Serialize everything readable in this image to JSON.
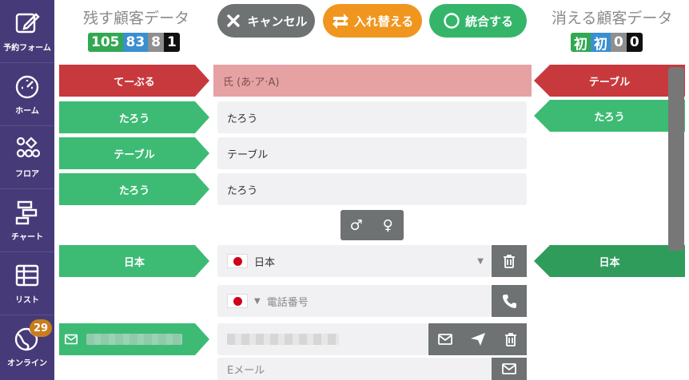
{
  "sidebar": {
    "items": [
      {
        "label": "予約フォーム",
        "icon": "edit-icon"
      },
      {
        "label": "ホーム",
        "icon": "gauge-icon"
      },
      {
        "label": "フロア",
        "icon": "shapes-icon"
      },
      {
        "label": "チャート",
        "icon": "chart-blocks-icon"
      },
      {
        "label": "リスト",
        "icon": "table-icon"
      },
      {
        "label": "オンライン",
        "icon": "globe-icon",
        "badge": "29"
      }
    ]
  },
  "header": {
    "left_title": "残す顧客データ",
    "right_title": "消える顧客データ",
    "left_counters": [
      "105",
      "83",
      "8",
      "1"
    ],
    "right_counters": [
      "初",
      "初",
      "0",
      "0"
    ],
    "cancel_label": "キャンセル",
    "swap_label": "入れ替える",
    "merge_label": "統合する"
  },
  "rows": {
    "name_kana_label": "てーぶる",
    "name_kana_placeholder": "氏 (あ·ア·A)",
    "name_kana_right": "テーブル",
    "given_kana_label": "たろう",
    "given_kana_value": "たろう",
    "given_kana_right": "たろう",
    "family_label": "テーブル",
    "family_value": "テーブル",
    "given_label": "たろう",
    "given_value": "たろう",
    "gender_male": "♂",
    "gender_female": "♀",
    "country_label": "日本",
    "country_value": "日本",
    "country_right": "日本",
    "phone_placeholder": "電話番号",
    "email_placeholder": "Eメール"
  },
  "colors": {
    "sidebar": "#473a78",
    "red": "#c8393d",
    "green": "#3dbb74",
    "orange": "#f0961e",
    "gray": "#6f7273"
  }
}
